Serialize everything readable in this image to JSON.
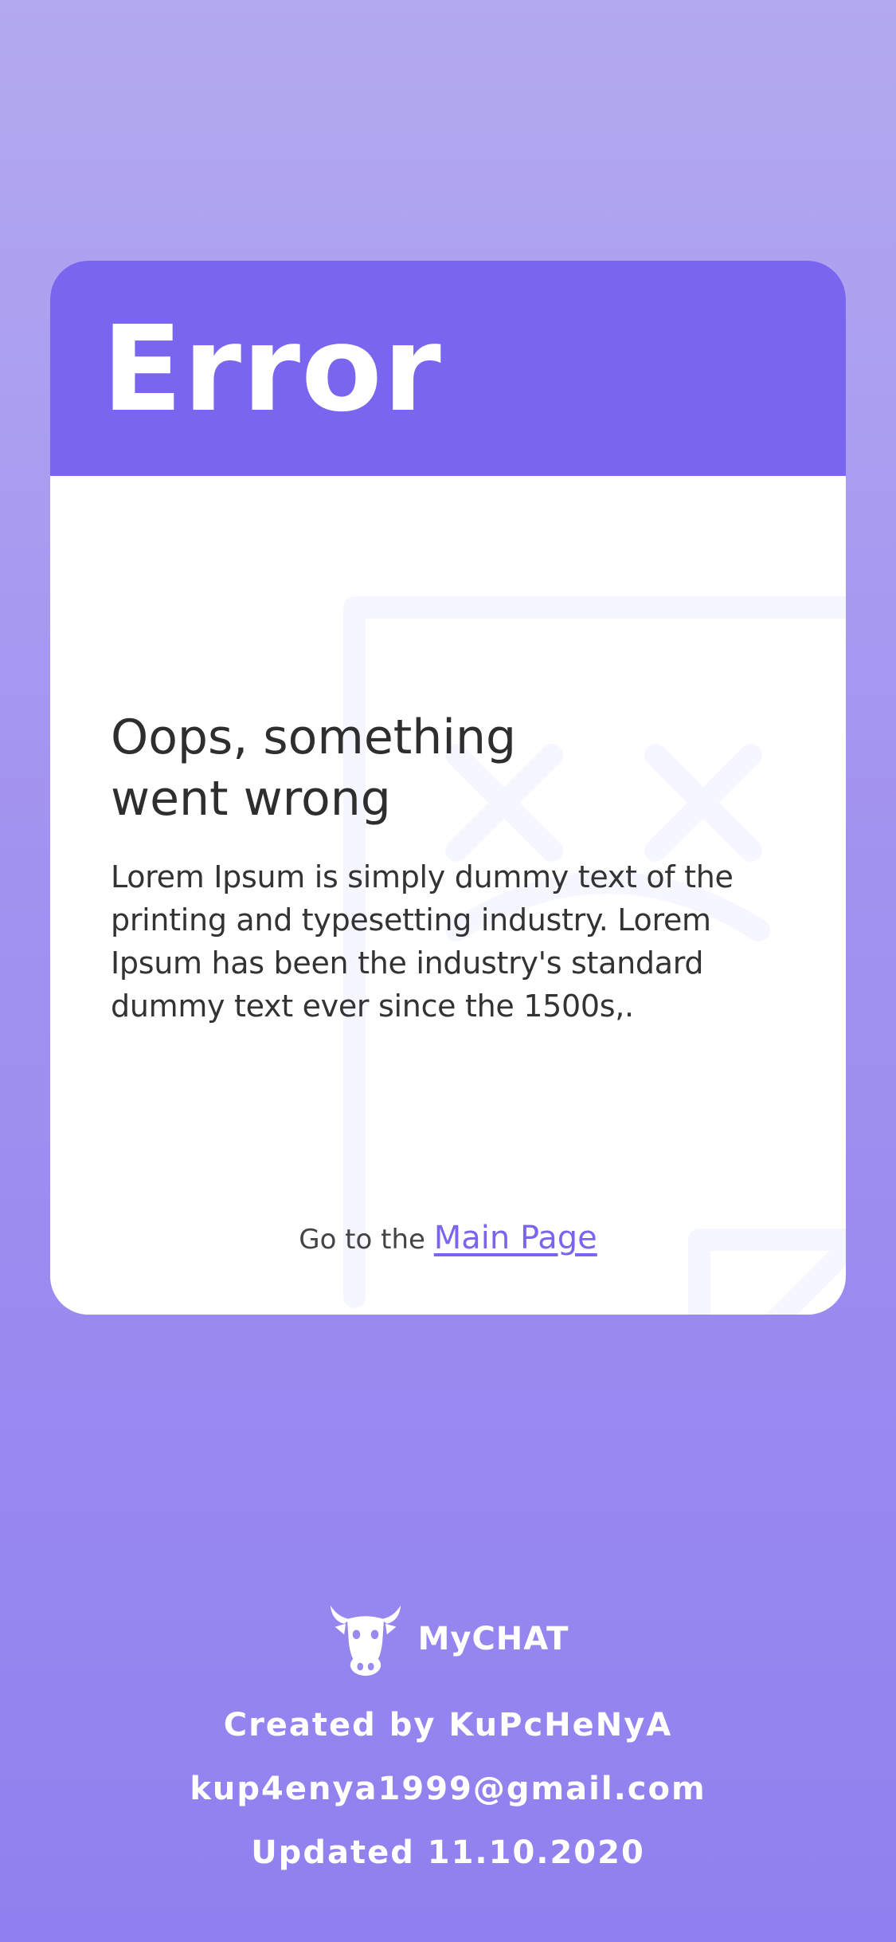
{
  "error_card": {
    "title": "Error",
    "heading": "Oops, something went wrong",
    "body": "Lorem Ipsum is simply dummy text of the printing and typesetting industry. Lorem Ipsum has been the industry's standard dummy text ever since the 1500s,.",
    "goto_prefix": "Go to the ",
    "goto_link": "Main Page"
  },
  "footer": {
    "brand_name": "MyCHAT",
    "brand_icon": "bull-head-icon",
    "credit": "Created by KuPcHeNyA",
    "email": "kup4enya1999@gmail.com",
    "updated": "Updated 11.10.2020"
  },
  "colors": {
    "accent": "#7a66ee",
    "background_top": "#b3a9f0",
    "background_bottom": "#9080ef",
    "card": "#ffffff",
    "text_dark": "#2e2e2e"
  }
}
